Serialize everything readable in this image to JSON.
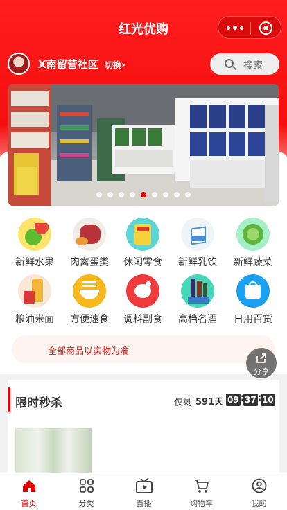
{
  "app": {
    "title": "红光优购"
  },
  "location": {
    "community": "X南留营社区",
    "switch_label": "切换"
  },
  "search": {
    "label": "搜索"
  },
  "banner": {
    "slide_count": 9,
    "active_index": 4
  },
  "categories": [
    {
      "label": "新鲜水果",
      "icon": "fruit-icon"
    },
    {
      "label": "肉禽蛋类",
      "icon": "meat-icon"
    },
    {
      "label": "休闲零食",
      "icon": "snack-icon"
    },
    {
      "label": "新鲜乳饮",
      "icon": "milk-icon"
    },
    {
      "label": "新鲜蔬菜",
      "icon": "vegetable-icon"
    },
    {
      "label": "粮油米面",
      "icon": "grain-oil-icon"
    },
    {
      "label": "方便速食",
      "icon": "instant-noodle-icon"
    },
    {
      "label": "调料副食",
      "icon": "seasoning-icon"
    },
    {
      "label": "高档名酒",
      "icon": "liquor-icon"
    },
    {
      "label": "日用百货",
      "icon": "daily-goods-icon"
    }
  ],
  "notice": {
    "text": "全部商品以实物为准"
  },
  "share": {
    "label": "分享"
  },
  "flash_sale": {
    "title": "限时秒杀",
    "remaining_label": "仅剩",
    "days": "591天",
    "hours": "09",
    "minutes": "37",
    "seconds": "10"
  },
  "tabbar": [
    {
      "label": "首页",
      "icon": "home-icon",
      "active": true
    },
    {
      "label": "分类",
      "icon": "category-icon",
      "active": false
    },
    {
      "label": "直播",
      "icon": "live-icon",
      "active": false
    },
    {
      "label": "购物车",
      "icon": "cart-icon",
      "active": false
    },
    {
      "label": "我的",
      "icon": "profile-icon",
      "active": false
    }
  ],
  "colors": {
    "brand_red": "#e60000",
    "header_red": "#ff1d1d",
    "notice_bg": "#fdf3ef"
  }
}
